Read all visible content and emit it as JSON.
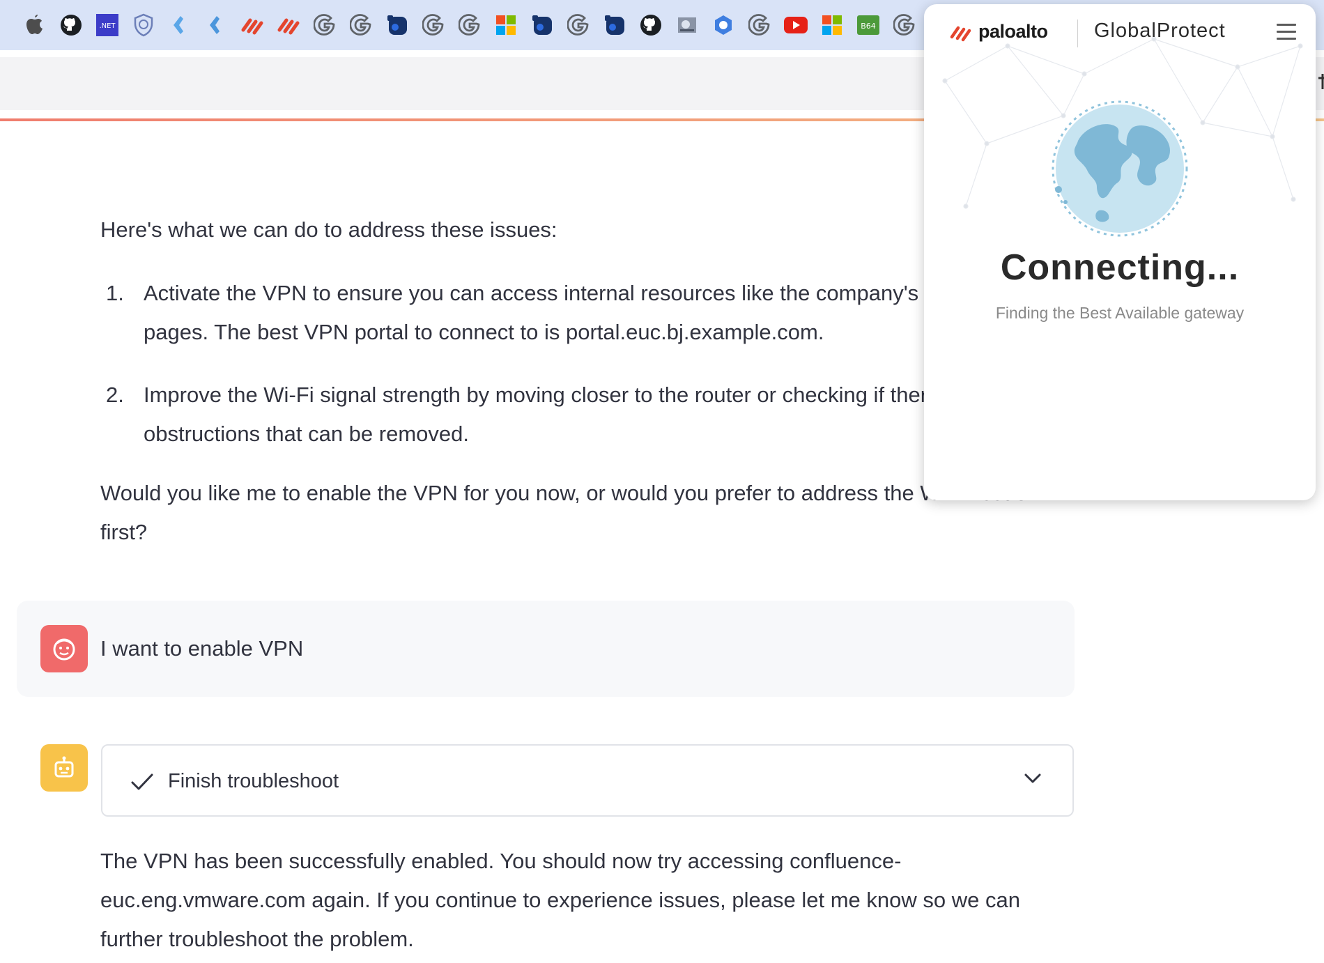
{
  "bookmarks_bar": {
    "icons": [
      "apple-icon",
      "github-icon",
      "dotnet-icon",
      "shield-icon",
      "diamond-icon",
      "diamond-icon",
      "paloalto-icon",
      "paloalto-icon",
      "google-icon",
      "google-icon",
      "blue-app-icon",
      "google-icon",
      "google-icon",
      "microsoft-icon",
      "blue-app-icon",
      "google-icon",
      "blue-app-icon",
      "github-icon",
      "grey-app-icon",
      "hexagon-icon",
      "google-icon",
      "youtube-icon",
      "microsoft-icon",
      "base64-icon",
      "google-icon"
    ],
    "dotnet_label": ".NET",
    "base64_label": "B64"
  },
  "chat": {
    "intro": "Here's what we can do to address these issues:",
    "steps": [
      {
        "num": "1.",
        "text": "Activate the VPN to ensure you can access internal resources like the company's Confluence pages. The best VPN portal to connect to is portal.euc.bj.example.com."
      },
      {
        "num": "2.",
        "text": "Improve the Wi-Fi signal strength by moving closer to the router or checking if there are any obstructions that can be removed."
      }
    ],
    "question": "Would you like me to enable the VPN for you now, or would you prefer to address the Wi-Fi issue first?",
    "user_message": "I want to enable VPN",
    "expander_label": "Finish troubleshoot",
    "result": "The VPN has been successfully enabled. You should now try accessing confluence-euc.eng.vmware.com again. If you continue to experience issues, please let me know so we can further troubleshoot the problem."
  },
  "globalprotect": {
    "brand": "paloalto",
    "product": "GlobalProtect",
    "status": "Connecting...",
    "substatus": "Finding the Best Available gateway"
  },
  "colors": {
    "bookmarks_bg": "#d9e3f7",
    "user_avatar": "#f06a6a",
    "bot_avatar": "#f8c34a",
    "paloalto_orange": "#e4452e",
    "globe_ocean": "#bfe0ee",
    "globe_land": "#7fb8d6"
  }
}
